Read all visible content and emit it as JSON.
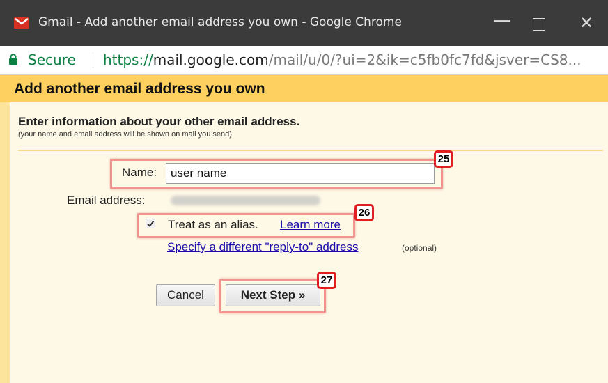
{
  "window": {
    "title": "Gmail - Add another email address you own - Google Chrome",
    "minimize_glyph": "—",
    "close_glyph": "✕"
  },
  "addressbar": {
    "secure_label": "Secure",
    "url_proto": "https://",
    "url_host": "mail.google.com",
    "url_path": "/mail/u/0/?ui=2&ik=c5fb0fc7fd&jsver=CS8..."
  },
  "dialog": {
    "title": "Add another email address you own",
    "intro_title": "Enter information about your other email address.",
    "intro_subtitle": "(your name and email address will be shown on mail you send)"
  },
  "form": {
    "name_label": "Name:",
    "name_value": "user name",
    "email_label": "Email address:",
    "alias_checked": true,
    "alias_label": "Treat as an alias.",
    "learn_more": "Learn more",
    "reply_to_link": "Specify a different \"reply-to\" address",
    "optional_note": "(optional)",
    "cancel_label": "Cancel",
    "next_label": "Next Step »"
  },
  "annotations": {
    "step_25": "25",
    "step_26": "26",
    "step_27": "27",
    "highlight_color": "#f1938e",
    "badge_color": "#e02020"
  },
  "colors": {
    "header_bg": "#fdd05f",
    "content_bg": "#fef9e6",
    "link": "#1a0dab",
    "secure": "#0b8043",
    "titlebar": "#3b3b3b"
  },
  "icons": {
    "app": "gmail-icon",
    "secure": "lock-icon",
    "checkbox": "checkmark-icon"
  }
}
